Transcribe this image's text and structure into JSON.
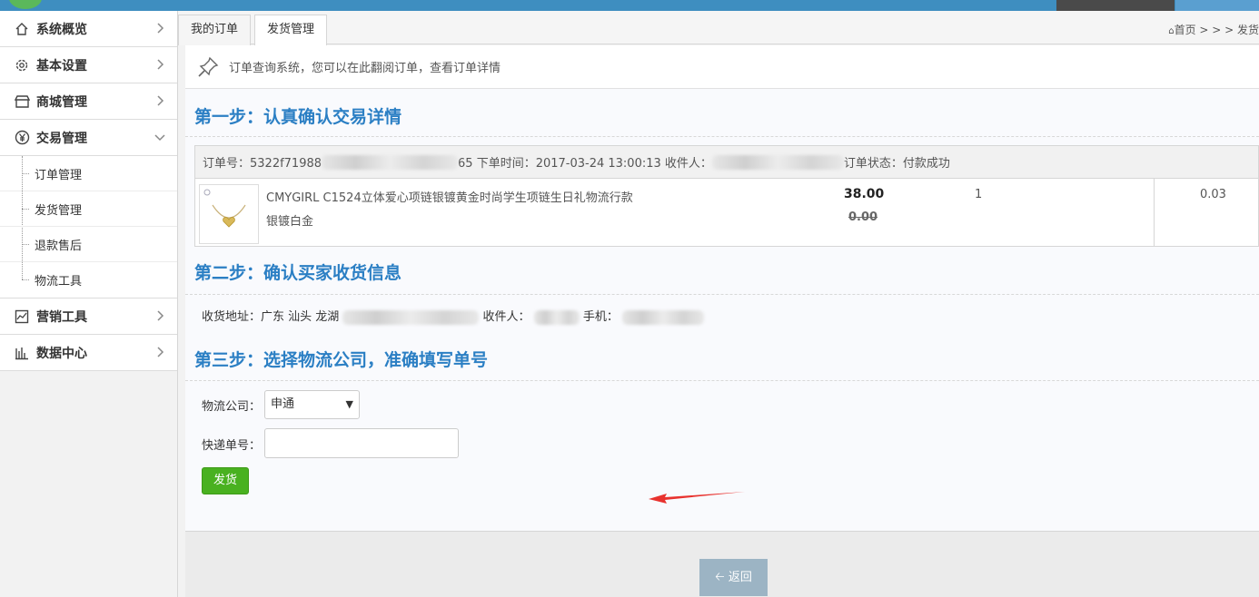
{
  "sidebar": {
    "items": [
      {
        "label": "系统概览",
        "icon": "home-icon"
      },
      {
        "label": "基本设置",
        "icon": "gear-icon"
      },
      {
        "label": "商城管理",
        "icon": "store-icon"
      },
      {
        "label": "交易管理",
        "icon": "yen-icon"
      },
      {
        "label": "营销工具",
        "icon": "chart-line-icon"
      },
      {
        "label": "数据中心",
        "icon": "bar-chart-icon"
      }
    ],
    "trade_submenu": [
      "订单管理",
      "发货管理",
      "退款售后",
      "物流工具"
    ]
  },
  "tabs": [
    {
      "label": "我的订单"
    },
    {
      "label": "发货管理"
    }
  ],
  "breadcrumb": "首页 > > > 发货",
  "info": "订单查询系统，您可以在此翻阅订单，查看订单详情",
  "step1": {
    "title": "第一步：认真确认交易详情",
    "order_no_prefix": "订单号：5322f71988",
    "order_no_suffix": "65 下单时间：2017-03-24 13:00:13 收件人：",
    "order_status": "订单状态：付款成功",
    "product_name": "CMYGIRL C1524立体爱心项链银镀黄金时尚学生项链生日礼物流行款",
    "product_spec": "银镀白金",
    "price": "38.00",
    "old_price": "0.00",
    "quantity": "1",
    "amount": "0.03"
  },
  "step2": {
    "title": "第二步：确认买家收货信息",
    "addr_prefix": "收货地址：广东 汕头 龙湖",
    "receiver_label": "收件人：",
    "phone_label": "手机："
  },
  "step3": {
    "title": "第三步：选择物流公司，准确填写单号",
    "company_label": "物流公司：",
    "company_value": "申通",
    "tracking_label": "快递单号：",
    "tracking_value": "",
    "ship_button": "发货"
  },
  "back_button": "返回",
  "colors": {
    "accent": "#2b7fc4",
    "ship_green": "#49b120",
    "topbar": "#3e8ec0"
  }
}
